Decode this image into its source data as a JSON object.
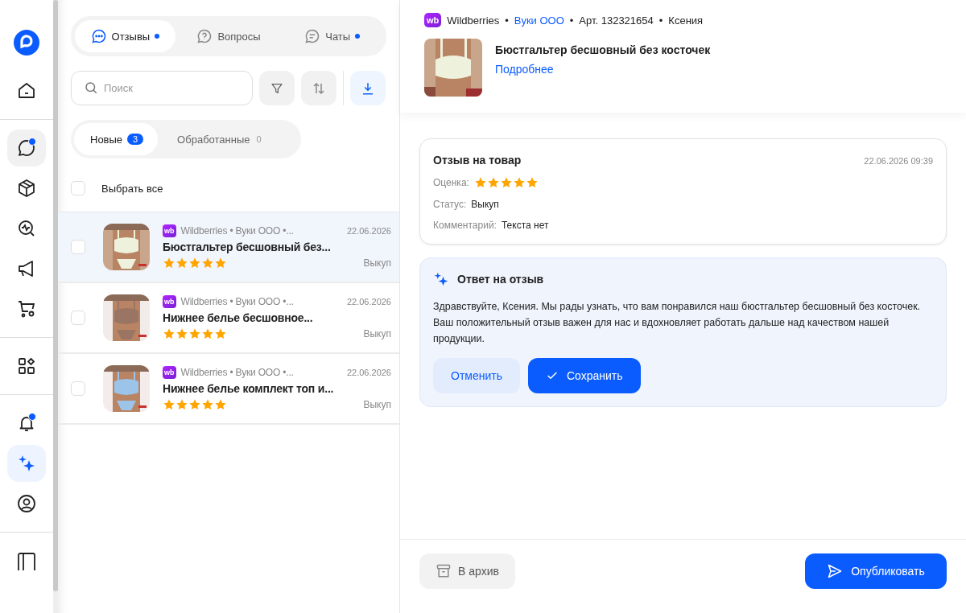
{
  "sidebar": {
    "groups": [
      [
        {
          "kind": "logo",
          "selected": false,
          "badge": false
        },
        {
          "kind": "home",
          "selected": false,
          "badge": false
        }
      ],
      [
        {
          "kind": "chat",
          "selected": true,
          "badge": true
        },
        {
          "kind": "box",
          "selected": false,
          "badge": false
        },
        {
          "kind": "analytics",
          "selected": false,
          "badge": false
        },
        {
          "kind": "megaphone",
          "selected": false,
          "badge": false
        },
        {
          "kind": "cart",
          "selected": false,
          "badge": false
        }
      ],
      [
        {
          "kind": "apps",
          "selected": false,
          "badge": false
        }
      ],
      [
        {
          "kind": "bell",
          "selected": false,
          "badge": true
        },
        {
          "kind": "sparkle",
          "selected": true,
          "badge": false
        },
        {
          "kind": "user",
          "selected": false,
          "badge": false
        }
      ],
      [
        {
          "kind": "panel",
          "selected": false,
          "badge": false
        }
      ]
    ]
  },
  "tabs": [
    {
      "kind": "reviews",
      "label": "Отзывы",
      "selected": true,
      "dot": true
    },
    {
      "kind": "questions",
      "label": "Вопросы",
      "selected": false,
      "dot": false
    },
    {
      "kind": "chats",
      "label": "Чаты",
      "selected": false,
      "dot": true
    }
  ],
  "search": {
    "placeholder": "Поиск"
  },
  "filter_tabs": [
    {
      "label": "Новые",
      "count": "3",
      "selected": true
    },
    {
      "label": "Обработанные",
      "count": "0",
      "selected": false
    }
  ],
  "select_all": {
    "label": "Выбрать все",
    "checked": false
  },
  "reviews": [
    {
      "badge": "wb",
      "source": "Wildberries • Вуки ООО •...",
      "date": "22.06.2026",
      "title": "Бюстгальтер бесшовный без...",
      "stars": 5,
      "status": "Выкуп",
      "selected": true,
      "checked": false
    },
    {
      "badge": "wb",
      "source": "Wildberries • Вуки ООО •...",
      "date": "22.06.2026",
      "title": "Нижнее белье бесшовное...",
      "stars": 5,
      "status": "Выкуп",
      "selected": false,
      "checked": false
    },
    {
      "badge": "wb",
      "source": "Wildberries • Вуки ООО •...",
      "date": "22.06.2026",
      "title": "Нижнее белье комплект топ и...",
      "stars": 5,
      "status": "Выкуп",
      "selected": false,
      "checked": false
    }
  ],
  "detail": {
    "badge": "wb",
    "meta": [
      {
        "kind": "text",
        "text": "Wildberries"
      },
      {
        "kind": "sep",
        "text": "•"
      },
      {
        "kind": "link",
        "text": "Вуки ООО"
      },
      {
        "kind": "sep",
        "text": "•"
      },
      {
        "kind": "text",
        "text": "Арт. 132321654"
      },
      {
        "kind": "sep",
        "text": "•"
      },
      {
        "kind": "text",
        "text": "Ксения"
      }
    ],
    "product_title": "Бюстгальтер бесшовный без косточек",
    "more_link": "Подробнее",
    "review": {
      "title": "Отзыв на товар",
      "date": "22.06.2026 09:39",
      "rating_label": "Оценка:",
      "stars": 5,
      "status_label": "Статус:",
      "status": "Выкуп",
      "comment_label": "Комментарий:",
      "comment": "Текста нет"
    },
    "answer": {
      "title": "Ответ на отзыв",
      "text": "Здравствуйте, Ксения. Мы рады узнать, что вам понравился наш бюстгальтер бесшовный без косточек. Ваш положительный отзыв важен для нас и вдохновляет работать дальше над качеством нашей продукции.",
      "cancel": "Отменить",
      "save": "Сохранить"
    },
    "footer": {
      "archive": "В архив",
      "publish": "Опубликовать"
    }
  }
}
